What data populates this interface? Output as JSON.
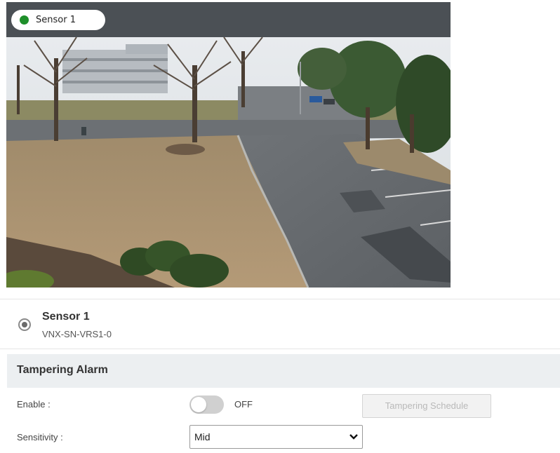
{
  "camera": {
    "badge_label": "Sensor 1",
    "status_color": "#1e8f2a",
    "status_icon": "online-dot-icon"
  },
  "sensor": {
    "name": "Sensor 1",
    "id": "VNX-SN-VRS1-0",
    "selected": true
  },
  "tampering": {
    "section_title": "Tampering Alarm",
    "enable_label": "Enable :",
    "enable_state": "OFF",
    "enabled": false,
    "schedule_button_label": "Tampering Schedule",
    "schedule_button_disabled": true,
    "sensitivity_label": "Sensitivity :",
    "sensitivity_value": "Mid"
  },
  "colors": {
    "header_bar": "#4b5055",
    "section_bg": "#eceff1",
    "toggle_off": "#d0d0d0"
  }
}
